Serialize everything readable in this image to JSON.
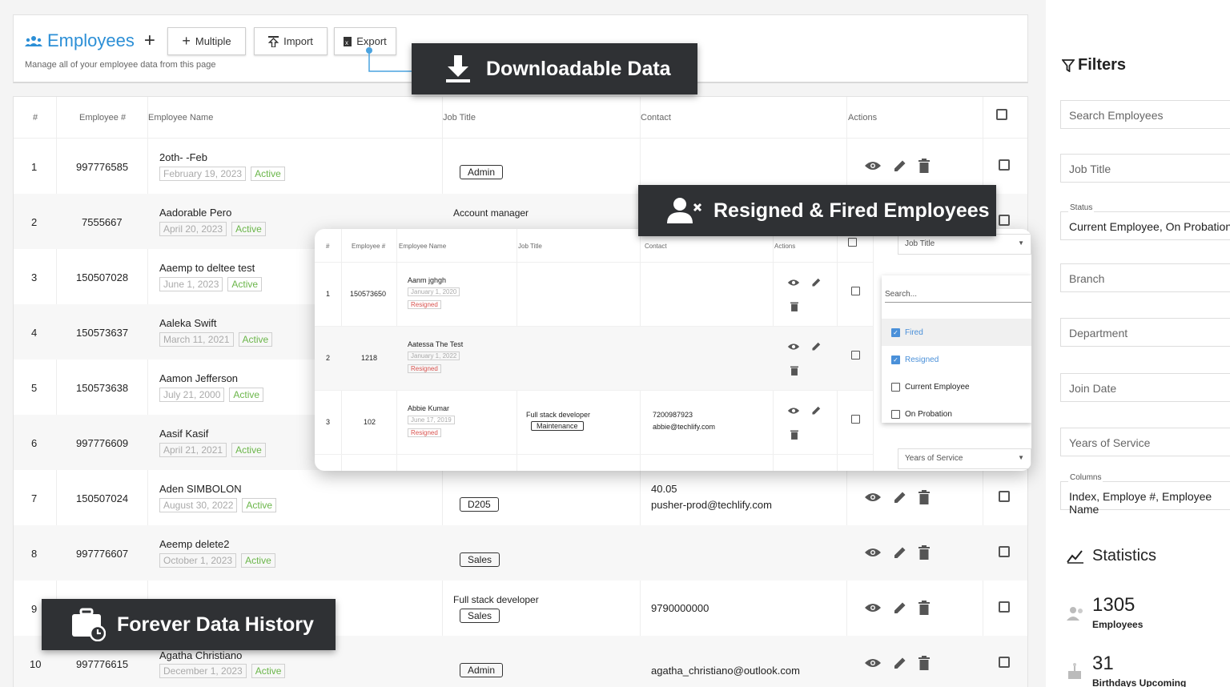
{
  "header": {
    "title": "Employees",
    "add_label": "+",
    "buttons": {
      "multiple": "Multiple",
      "import": "Import",
      "export": "Export"
    },
    "subtitle": "Manage all of your employee data from this page"
  },
  "table": {
    "columns": [
      "#",
      "Employee #",
      "Employee Name",
      "Job Title",
      "Contact",
      "Actions"
    ],
    "rows": [
      {
        "index": "1",
        "emp_no": "997776585",
        "name": "2oth- -Feb",
        "date": "February 19, 2023",
        "status": "Active",
        "job_badge": "Admin",
        "job_text": "",
        "contact1": "",
        "contact2": ""
      },
      {
        "index": "2",
        "emp_no": "7555667",
        "name": "Aadorable Pero",
        "date": "April 20, 2023",
        "status": "Active",
        "job_badge": "",
        "job_text": "Account manager",
        "contact1": "",
        "contact2": ""
      },
      {
        "index": "3",
        "emp_no": "150507028",
        "name": "Aaemp to deltee test",
        "date": "June 1, 2023",
        "status": "Active",
        "job_badge": "",
        "job_text": "",
        "contact1": "",
        "contact2": ""
      },
      {
        "index": "4",
        "emp_no": "150573637",
        "name": "Aaleka Swift",
        "date": "March 11, 2021",
        "status": "Active",
        "job_badge": "",
        "job_text": "",
        "contact1": "",
        "contact2": ""
      },
      {
        "index": "5",
        "emp_no": "150573638",
        "name": "Aamon Jefferson",
        "date": "July 21, 2000",
        "status": "Active",
        "job_badge": "",
        "job_text": "",
        "contact1": "",
        "contact2": ""
      },
      {
        "index": "6",
        "emp_no": "997776609",
        "name": "Aasif Kasif",
        "date": "April 21, 2021",
        "status": "Active",
        "job_badge": "",
        "job_text": "",
        "contact1": "",
        "contact2": ""
      },
      {
        "index": "7",
        "emp_no": "150507024",
        "name": "Aden SIMBOLON",
        "date": "August 30, 2022",
        "status": "Active",
        "job_badge": "D205",
        "job_text": "",
        "contact1": "40.05",
        "contact2": "pusher-prod@techlify.com"
      },
      {
        "index": "8",
        "emp_no": "997776607",
        "name": "Aeemp delete2",
        "date": "October 1, 2023",
        "status": "Active",
        "job_badge": "Sales",
        "job_text": "",
        "contact1": "",
        "contact2": ""
      },
      {
        "index": "9",
        "emp_no": "",
        "name": "",
        "date": "",
        "status": "",
        "job_badge": "Sales",
        "job_text": "Full stack developer",
        "contact1": "9790000000",
        "contact2": ""
      },
      {
        "index": "10",
        "emp_no": "997776615",
        "name": "Agatha Christiano",
        "date": "December 1, 2023",
        "status": "Active",
        "job_badge": "Admin",
        "job_text": "",
        "contact1": "agatha_christiano@outlook.com",
        "contact2": ""
      }
    ]
  },
  "modal": {
    "columns": [
      "#",
      "Employee #",
      "Employee Name",
      "Job Title",
      "Contact",
      "Actions"
    ],
    "rows": [
      {
        "index": "1",
        "emp_no": "150573650",
        "name": "Aanm jghgh",
        "date": "January 1, 2020",
        "status": "Resigned",
        "job": "",
        "job_badge": "",
        "phone": "",
        "email": ""
      },
      {
        "index": "2",
        "emp_no": "1218",
        "name": "Aatessa The Test",
        "date": "January 1, 2022",
        "status": "Resigned",
        "job": "",
        "job_badge": "",
        "phone": "",
        "email": ""
      },
      {
        "index": "3",
        "emp_no": "102",
        "name": "Abbie Kumar",
        "date": "June 17, 2019",
        "status": "Resigned",
        "job": "Full stack developer",
        "job_badge": "Maintenance",
        "phone": "7200987923",
        "email": "abbie@techlify.com"
      }
    ],
    "job_title_select": "Job Title",
    "search_placeholder": "Search...",
    "options": [
      {
        "label": "Fired",
        "checked": true
      },
      {
        "label": "Resigned",
        "checked": true
      },
      {
        "label": "Current Employee",
        "checked": false
      },
      {
        "label": "On Probation",
        "checked": false
      }
    ],
    "years_select": "Years of Service"
  },
  "filters": {
    "title": "Filters",
    "search_placeholder": "Search Employees",
    "job_title": "Job Title",
    "status_label": "Status",
    "status_value": "Current Employee, On Probation",
    "branch": "Branch",
    "department": "Department",
    "join_date": "Join Date",
    "years": "Years of Service",
    "columns_label": "Columns",
    "columns_value": "Index, Employe #, Employee Name"
  },
  "statistics": {
    "title": "Statistics",
    "employees_count": "1305",
    "employees_label": "Employees",
    "birthdays_count": "31",
    "birthdays_label": "Birthdays Upcoming"
  },
  "callouts": {
    "download": "Downloadable Data",
    "resigned": "Resigned & Fired Employees",
    "history": "Forever Data History"
  },
  "colors": {
    "accent": "#2c8fd6",
    "active": "#6bb64a",
    "resigned": "#d9534f",
    "callout_bg": "#2f3134"
  }
}
